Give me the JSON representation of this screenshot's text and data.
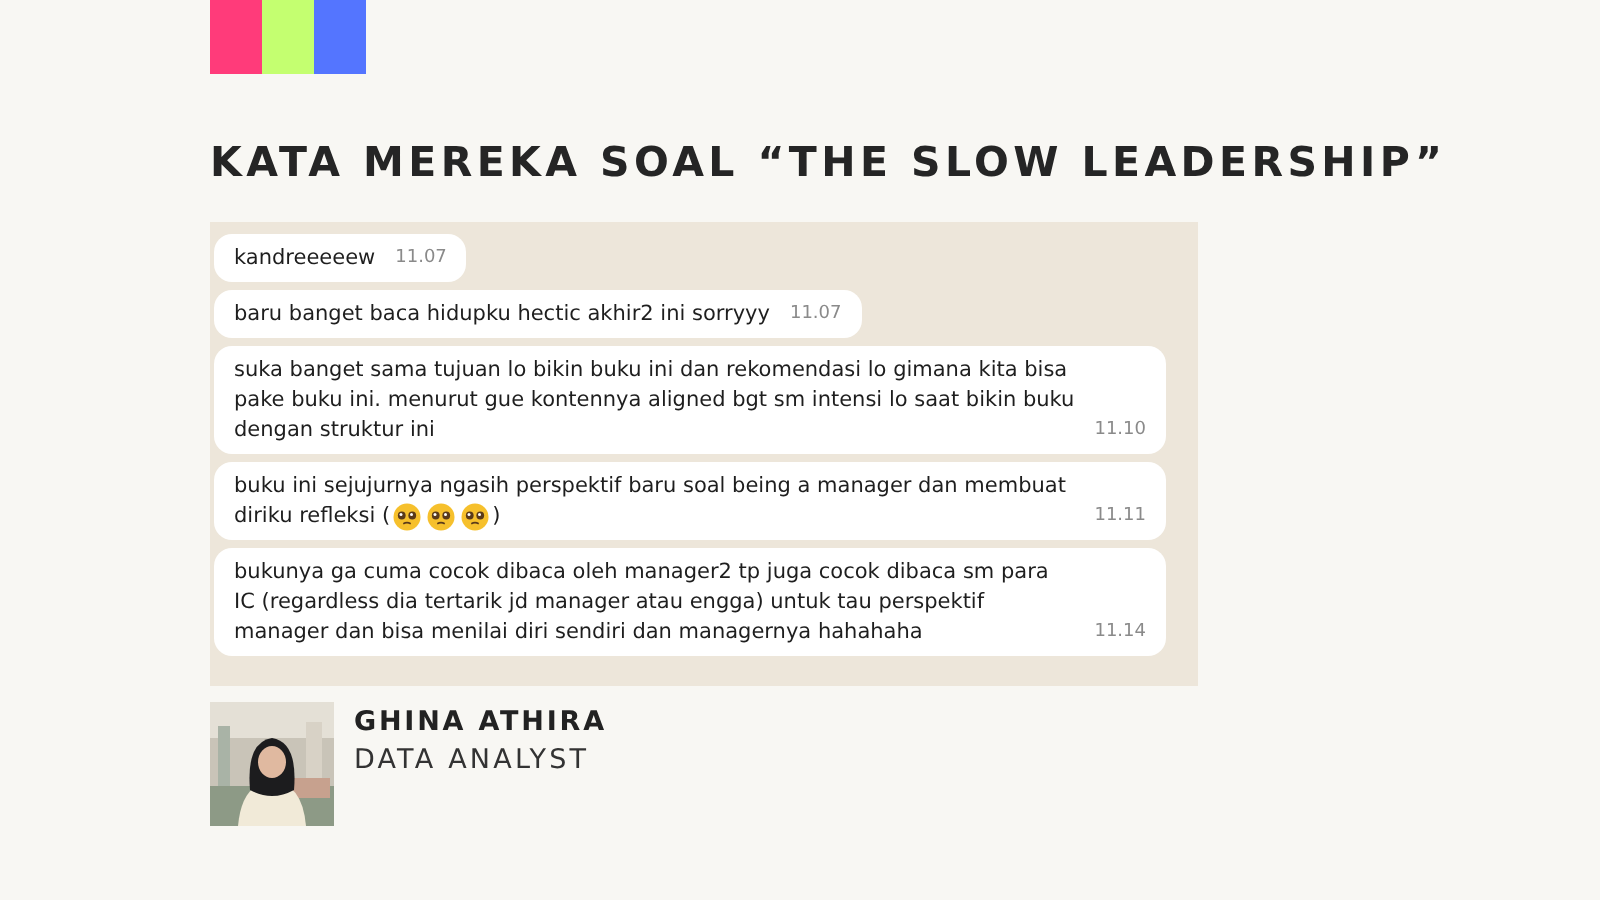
{
  "swatches": [
    {
      "color": "#ff3b7a"
    },
    {
      "color": "#c4ff70"
    },
    {
      "color": "#5475ff"
    }
  ],
  "title": "KATA MEREKA SOAL “THE SLOW LEADERSHIP”",
  "chat": {
    "messages": [
      {
        "text": "kandreeeeew",
        "time": "11.07"
      },
      {
        "text": "baru banget baca hidupku hectic akhir2 ini sorryyy",
        "time": "11.07"
      },
      {
        "text": "suka banget sama tujuan lo bikin buku ini dan rekomendasi lo gimana kita bisa pake buku ini. menurut gue kontennya aligned bgt sm intensi lo saat bikin buku dengan struktur ini",
        "time": "11.10"
      },
      {
        "text": "buku ini sejujurnya ngasih perspektif baru soal being a manager dan membuat",
        "tail": "diriku refleksi (",
        "suffix": ")",
        "time": "11.11"
      },
      {
        "text": "bukunya ga cuma cocok dibaca oleh manager2 tp juga cocok dibaca sm para IC (regardless dia tertarik jd manager atau engga) untuk tau perspektif manager dan bisa menilai diri sendiri dan managernya hahahaha",
        "time": "11.14"
      }
    ]
  },
  "author": {
    "name": "GHINA ATHIRA",
    "role": "DATA ANALYST"
  }
}
